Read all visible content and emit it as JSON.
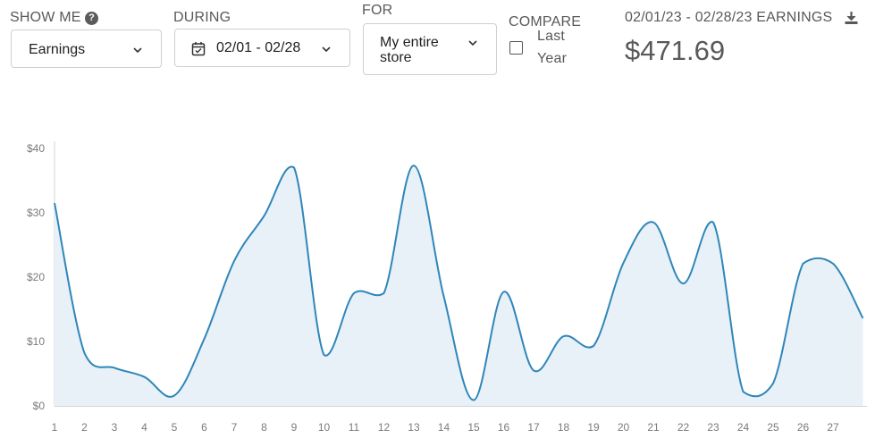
{
  "controls": {
    "show_me": {
      "label": "SHOW ME",
      "value": "Earnings"
    },
    "during": {
      "label": "DURING",
      "value": "02/01 - 02/28"
    },
    "for": {
      "label": "FOR",
      "value_line1": "My entire",
      "value_line2": "store"
    },
    "compare": {
      "label": "COMPARE",
      "option_line1": "Last",
      "option_line2": "Year",
      "checked": false
    }
  },
  "summary": {
    "range_label": "02/01/23 - 02/28/23 EARNINGS",
    "total": "$471.69"
  },
  "colors": {
    "line": "#2f86b9",
    "fill": "#e8f1f8",
    "axis": "#d5d5d5"
  },
  "icons": [
    "help-icon",
    "chevron-down-icon",
    "calendar-icon",
    "download-icon"
  ],
  "chart_data": {
    "type": "area",
    "x": [
      1,
      2,
      3,
      4,
      5,
      6,
      7,
      8,
      9,
      10,
      11,
      12,
      13,
      14,
      15,
      16,
      17,
      18,
      19,
      20,
      21,
      22,
      23,
      24,
      25,
      26,
      27,
      28
    ],
    "x_tick_labels": [
      "1",
      "2",
      "3",
      "4",
      "5",
      "6",
      "7",
      "8",
      "9",
      "10",
      "11",
      "12",
      "13",
      "14",
      "15",
      "16",
      "17",
      "18",
      "19",
      "20",
      "21",
      "22",
      "23",
      "24",
      "25",
      "26",
      "27"
    ],
    "values": [
      31.5,
      8.2,
      5.9,
      4.5,
      1.6,
      10.4,
      22.5,
      29.5,
      37.0,
      7.9,
      17.5,
      17.5,
      37.3,
      17.0,
      0.9,
      17.7,
      5.5,
      10.8,
      9.3,
      22.2,
      28.5,
      19.0,
      28.5,
      2.2,
      3.5,
      22.1,
      22.1,
      13.6
    ],
    "y_tick_labels": [
      "$0",
      "$10",
      "$20",
      "$30",
      "$40"
    ],
    "y_ticks": [
      0,
      10,
      20,
      30,
      40
    ],
    "ylim": [
      0,
      41.5
    ],
    "xlim": [
      1,
      28
    ],
    "grid": false
  }
}
